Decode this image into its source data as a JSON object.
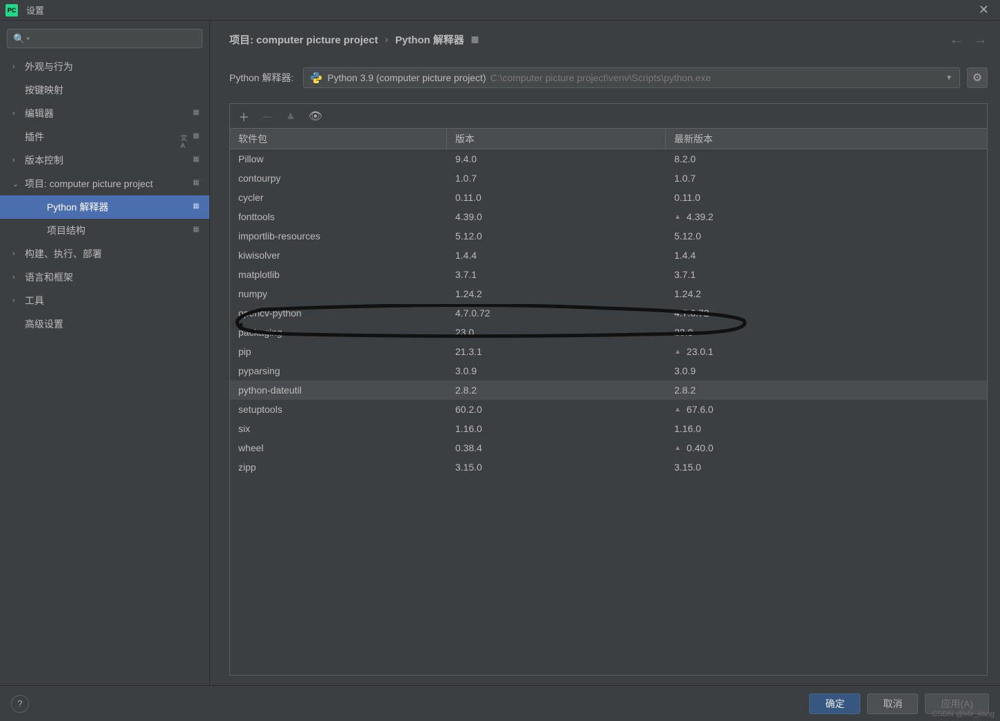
{
  "window": {
    "title": "设置",
    "app_icon_text": "PC"
  },
  "search": {
    "placeholder": ""
  },
  "sidebar": {
    "items": [
      {
        "label": "外观与行为",
        "expandable": true,
        "expanded": false
      },
      {
        "label": "按键映射",
        "expandable": false
      },
      {
        "label": "编辑器",
        "expandable": true,
        "expanded": false,
        "badge": true
      },
      {
        "label": "插件",
        "expandable": false,
        "lang_badge": true,
        "badge": true
      },
      {
        "label": "版本控制",
        "expandable": true,
        "expanded": false,
        "badge": true
      },
      {
        "label": "项目: computer picture project",
        "expandable": true,
        "expanded": true,
        "badge": true
      },
      {
        "label": "Python 解释器",
        "child": true,
        "selected": true,
        "badge": true
      },
      {
        "label": "项目结构",
        "child": true,
        "badge": true
      },
      {
        "label": "构建、执行、部署",
        "expandable": true,
        "expanded": false
      },
      {
        "label": "语言和框架",
        "expandable": true,
        "expanded": false
      },
      {
        "label": "工具",
        "expandable": true,
        "expanded": false
      },
      {
        "label": "高级设置",
        "expandable": false
      }
    ]
  },
  "breadcrumb": {
    "part1": "项目: computer picture project",
    "part2": "Python 解释器"
  },
  "interpreter": {
    "label": "Python 解释器:",
    "name": "Python 3.9 (computer picture project)",
    "path": "C:\\computer picture project\\venv\\Scripts\\python.exe"
  },
  "packages": {
    "columns": {
      "name": "软件包",
      "version": "版本",
      "latest": "最新版本"
    },
    "rows": [
      {
        "name": "Pillow",
        "version": "9.4.0",
        "latest": "8.2.0"
      },
      {
        "name": "contourpy",
        "version": "1.0.7",
        "latest": "1.0.7"
      },
      {
        "name": "cycler",
        "version": "0.11.0",
        "latest": "0.11.0"
      },
      {
        "name": "fonttools",
        "version": "4.39.0",
        "latest": "4.39.2",
        "upgrade": true
      },
      {
        "name": "importlib-resources",
        "version": "5.12.0",
        "latest": "5.12.0"
      },
      {
        "name": "kiwisolver",
        "version": "1.4.4",
        "latest": "1.4.4"
      },
      {
        "name": "matplotlib",
        "version": "3.7.1",
        "latest": "3.7.1"
      },
      {
        "name": "numpy",
        "version": "1.24.2",
        "latest": "1.24.2"
      },
      {
        "name": "opencv-python",
        "version": "4.7.0.72",
        "latest": "4.7.0.72"
      },
      {
        "name": "packaging",
        "version": "23.0",
        "latest": "23.0"
      },
      {
        "name": "pip",
        "version": "21.3.1",
        "latest": "23.0.1",
        "upgrade": true
      },
      {
        "name": "pyparsing",
        "version": "3.0.9",
        "latest": "3.0.9"
      },
      {
        "name": "python-dateutil",
        "version": "2.8.2",
        "latest": "2.8.2",
        "hover": true
      },
      {
        "name": "setuptools",
        "version": "60.2.0",
        "latest": "67.6.0",
        "upgrade": true
      },
      {
        "name": "six",
        "version": "1.16.0",
        "latest": "1.16.0"
      },
      {
        "name": "wheel",
        "version": "0.38.4",
        "latest": "0.40.0",
        "upgrade": true
      },
      {
        "name": "zipp",
        "version": "3.15.0",
        "latest": "3.15.0"
      }
    ]
  },
  "footer": {
    "ok": "确定",
    "cancel": "取消",
    "apply": "应用(A)"
  },
  "watermark": "CSDN @Mir_kang"
}
